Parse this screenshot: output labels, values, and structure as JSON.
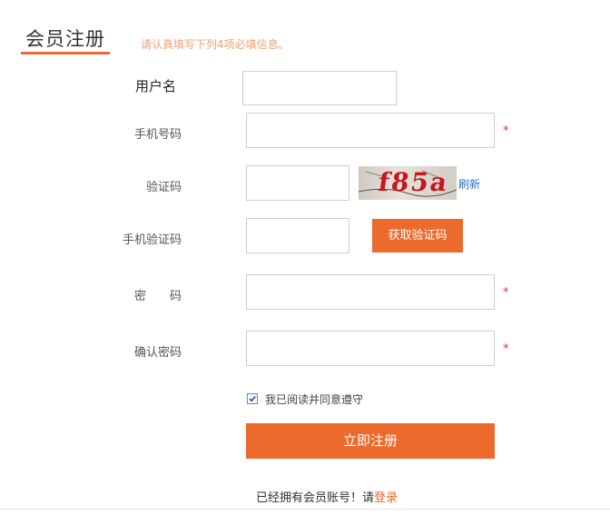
{
  "header": {
    "title": "会员注册",
    "hint": "请认真填写下列4项必填信息。"
  },
  "form": {
    "username": {
      "label": "用户名",
      "value": ""
    },
    "phone": {
      "label": "手机号码",
      "value": "",
      "required_mark": "*"
    },
    "captcha": {
      "label": "验证码",
      "value": "",
      "image_text": "f85a",
      "refresh_label": "刷新"
    },
    "sms_code": {
      "label": "手机验证码",
      "value": "",
      "get_code_label": "获取验证码"
    },
    "password": {
      "label": "密　　码",
      "value": "",
      "required_mark": "*"
    },
    "confirm_password": {
      "label": "确认密码",
      "value": "",
      "required_mark": "*"
    },
    "agreement": {
      "label": "我已阅读并同意遵守",
      "checked": true
    },
    "submit_label": "立即注册"
  },
  "footer": {
    "login_prompt": "已经拥有会员账号！请",
    "login_link": "登录"
  },
  "colors": {
    "accent": "#ec6a2c",
    "required": "#dd3333",
    "link": "#2a6cc4"
  }
}
